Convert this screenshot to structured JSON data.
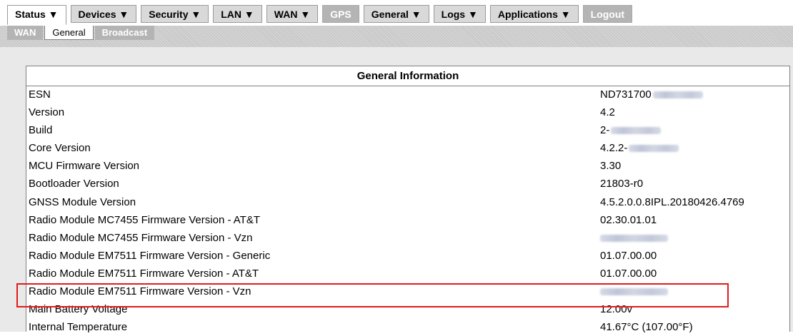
{
  "nav": {
    "menu": [
      {
        "label": "Status ▼",
        "state": "active"
      },
      {
        "label": "Devices ▼",
        "state": "normal"
      },
      {
        "label": "Security ▼",
        "state": "normal"
      },
      {
        "label": "LAN ▼",
        "state": "normal"
      },
      {
        "label": "WAN ▼",
        "state": "normal"
      },
      {
        "label": "GPS",
        "state": "disabled"
      },
      {
        "label": "General ▼",
        "state": "normal"
      },
      {
        "label": "Logs ▼",
        "state": "normal"
      },
      {
        "label": "Applications ▼",
        "state": "normal"
      },
      {
        "label": "Logout",
        "state": "disabled"
      }
    ],
    "submenu": [
      {
        "label": "WAN",
        "state": "normal"
      },
      {
        "label": "General",
        "state": "active"
      },
      {
        "label": "Broadcast",
        "state": "normal"
      }
    ]
  },
  "panel": {
    "title": "General Information",
    "rows": [
      {
        "label": "ESN",
        "value": "ND731700",
        "redacted": true
      },
      {
        "label": "Version",
        "value": "4.2"
      },
      {
        "label": "Build",
        "value": "2-",
        "redacted": true
      },
      {
        "label": "Core Version",
        "value": "4.2.2-",
        "redacted": true
      },
      {
        "label": "MCU Firmware Version",
        "value": "3.30"
      },
      {
        "label": "Bootloader Version",
        "value": "21803-r0"
      },
      {
        "label": "GNSS Module Version",
        "value": "4.5.2.0.0.8IPL.20180426.4769"
      },
      {
        "label": "Radio Module MC7455 Firmware Version - AT&T",
        "value": "02.30.01.01"
      },
      {
        "label": "Radio Module MC7455 Firmware Version - Vzn",
        "value": "",
        "redacted": true
      },
      {
        "label": "Radio Module EM7511 Firmware Version - Generic",
        "value": "01.07.00.00"
      },
      {
        "label": "Radio Module EM7511 Firmware Version - AT&T",
        "value": "01.07.00.00"
      },
      {
        "label": "Radio Module EM7511 Firmware Version - Vzn",
        "value": "",
        "redacted": true,
        "highlighted": true
      },
      {
        "label": "Main Battery Voltage",
        "value": "12.00v"
      },
      {
        "label": "Internal Temperature",
        "value": "41.67°C (107.00°F)"
      }
    ]
  },
  "colors": {
    "highlight_border": "#e11b1b",
    "menu_bg": "#d9d9d9",
    "disabled_bg": "#b4b4b4",
    "content_bg": "#e9e9e9"
  }
}
